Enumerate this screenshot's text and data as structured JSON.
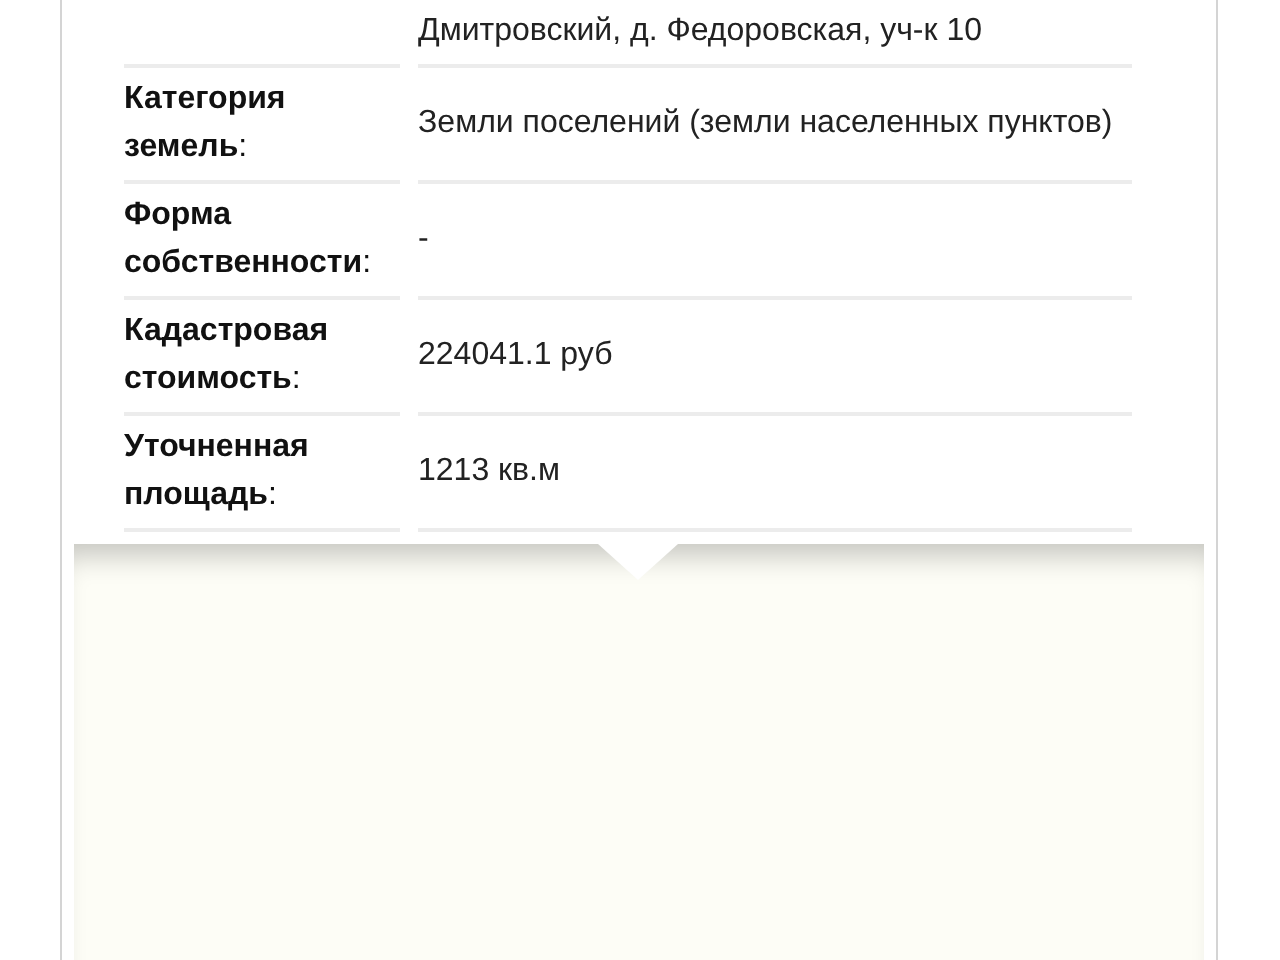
{
  "details": {
    "rows": [
      {
        "label": "",
        "value": "Дмитровский, д. Федоровская, уч-к 10"
      },
      {
        "label": "**Категория земель**:",
        "value": "Земли поселений (земли населенных пунктов)"
      },
      {
        "label": "**Форма собственности**:",
        "value": "-"
      },
      {
        "label": "**Кадастровая стоимость**:",
        "value": "224041.1 руб"
      },
      {
        "label": "**Уточненная площадь**:",
        "value": "1213 кв.м"
      }
    ]
  }
}
